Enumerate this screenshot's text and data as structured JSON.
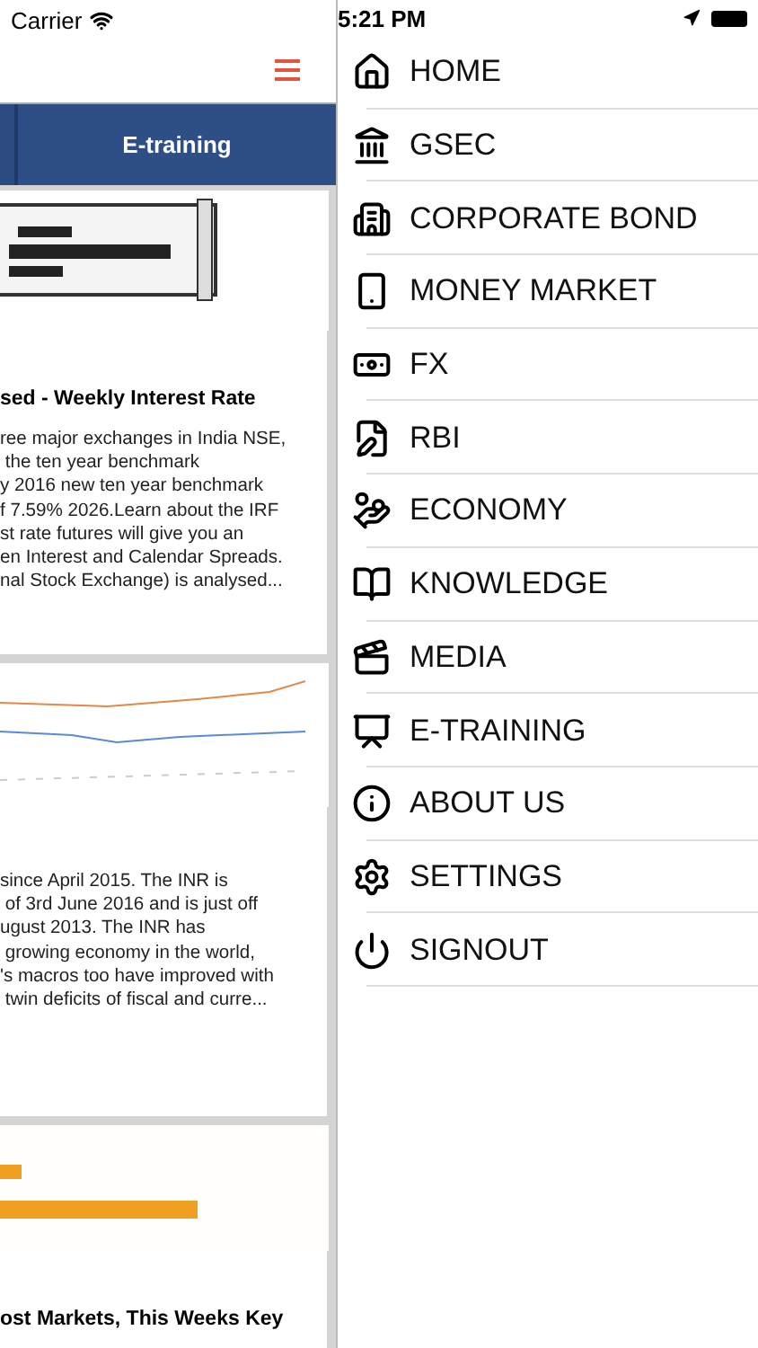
{
  "status_bar": {
    "carrier": "Carrier",
    "time": "5:21 PM"
  },
  "tabs": [
    {
      "label": "E-training",
      "selected": true
    }
  ],
  "cards": [
    {
      "title": "sed - Weekly Interest Rate",
      "text": "ree major exchanges in India NSE,\n the ten year benchmark\ny 2016 new ten year benchmark\nf 7.59% 2026.Learn about the IRF\nst rate futures will give you an\nen Interest and Calendar Spreads.\nnal Stock Exchange) is analysed..."
    },
    {
      "text": "since April 2015. The INR is\n of 3rd June 2016 and is just off\nugust 2013. The INR has\n growing economy in the world,\n's macros too have improved with\n twin deficits of fiscal and curre..."
    },
    {
      "title": "ost Markets, This Weeks Key"
    }
  ],
  "menu": [
    {
      "label": "HOME"
    },
    {
      "label": "GSEC"
    },
    {
      "label": "CORPORATE BOND"
    },
    {
      "label": "MONEY MARKET"
    },
    {
      "label": "FX"
    },
    {
      "label": "RBI"
    },
    {
      "label": "ECONOMY"
    },
    {
      "label": "KNOWLEDGE"
    },
    {
      "label": "MEDIA"
    },
    {
      "label": "E-TRAINING"
    },
    {
      "label": "ABOUT US"
    },
    {
      "label": "SETTINGS"
    },
    {
      "label": "SIGNOUT"
    }
  ]
}
